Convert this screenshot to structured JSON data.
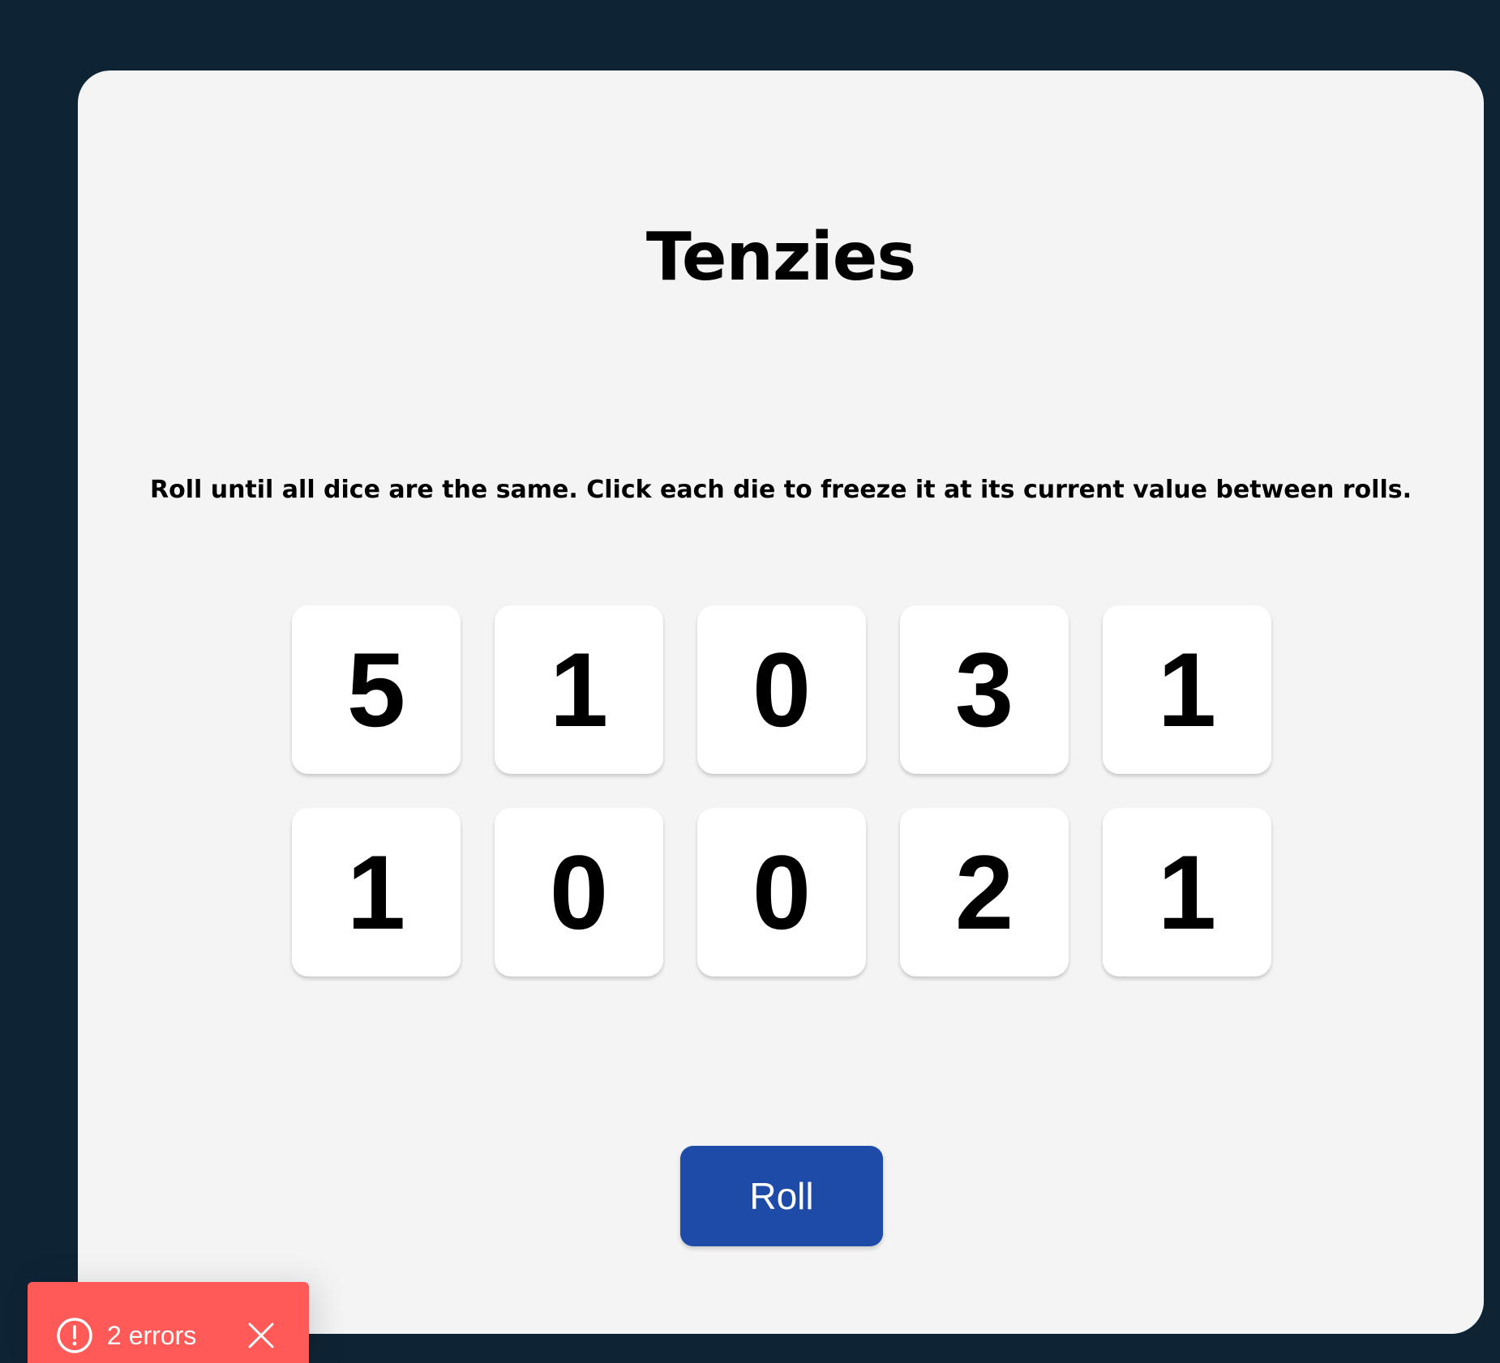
{
  "game": {
    "title": "Tenzies",
    "instructions": "Roll until all dice are the same. Click each die to freeze it at its current value between rolls.",
    "dice": [
      {
        "value": "5"
      },
      {
        "value": "1"
      },
      {
        "value": "0"
      },
      {
        "value": "3"
      },
      {
        "value": "1"
      },
      {
        "value": "1"
      },
      {
        "value": "0"
      },
      {
        "value": "0"
      },
      {
        "value": "2"
      },
      {
        "value": "1"
      }
    ],
    "roll_label": "Roll"
  },
  "error_toast": {
    "label": "2 errors",
    "icon": "alert-circle-icon",
    "close_icon": "close-icon"
  },
  "colors": {
    "page_background": "#0e2435",
    "card_background": "#f4f4f4",
    "die_background": "#ffffff",
    "roll_button": "#1e4ba8",
    "error_toast": "#ff5a57"
  }
}
